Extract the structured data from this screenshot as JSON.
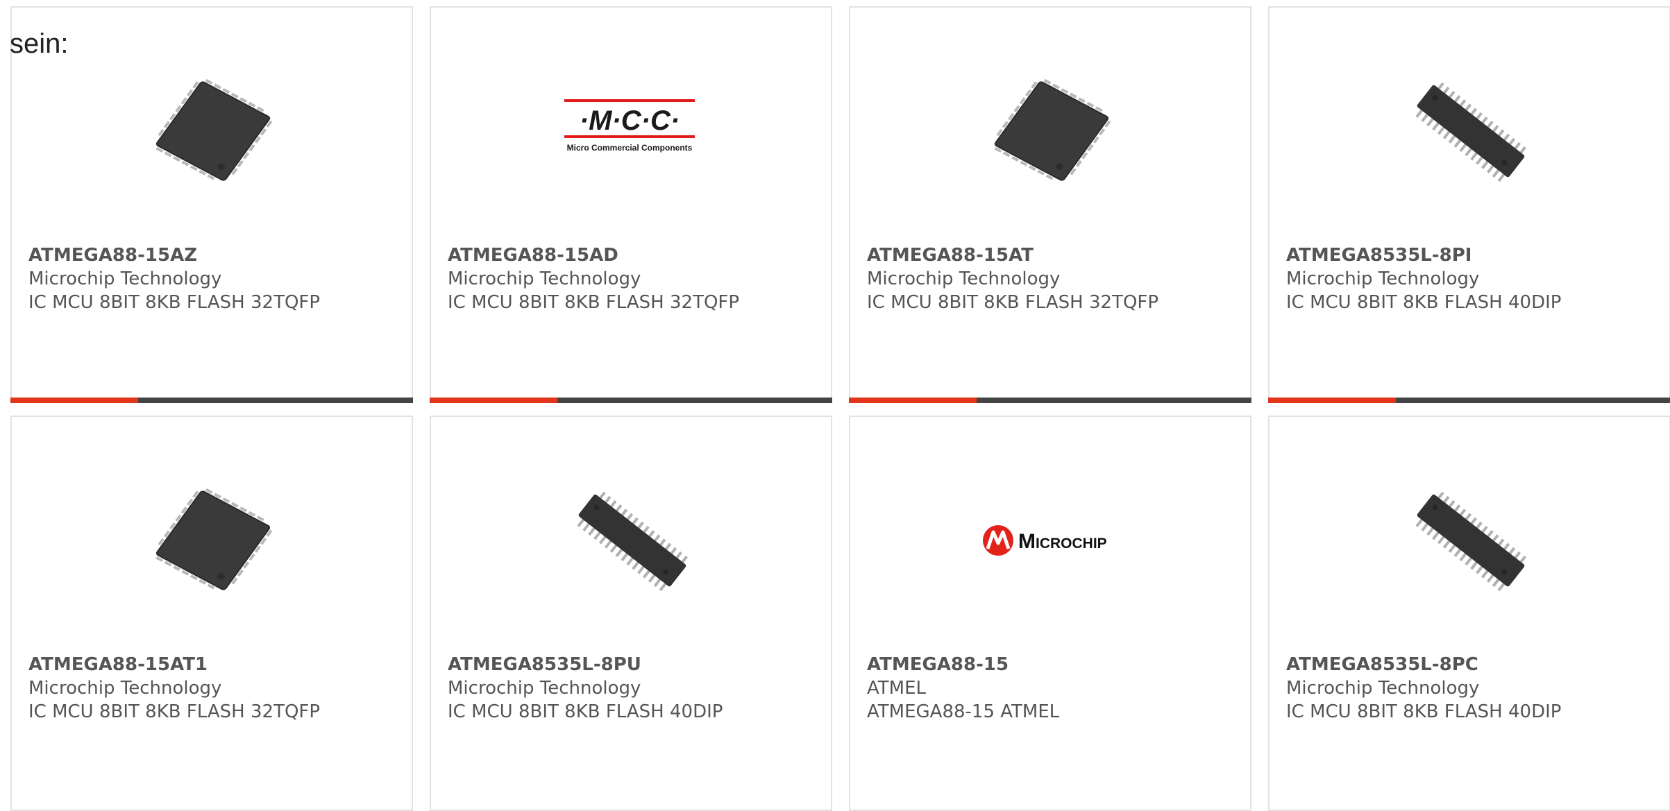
{
  "intro_text": "sein:",
  "colors": {
    "accent": "#e2361a",
    "bar": "#444444",
    "border": "#e2e2e2",
    "text": "#555555"
  },
  "products": [
    {
      "part": "ATMEGA88-15AZ",
      "manufacturer": "Microchip Technology",
      "description": "IC MCU 8BIT 8KB FLASH 32TQFP",
      "image": "tqfp-chip-icon"
    },
    {
      "part": "ATMEGA88-15AD",
      "manufacturer": "Microchip Technology",
      "description": "IC MCU 8BIT 8KB FLASH 32TQFP",
      "image": "mcc-logo",
      "logo_text": "·M·C·C·",
      "logo_subtext": "Micro Commercial Components"
    },
    {
      "part": "ATMEGA88-15AT",
      "manufacturer": "Microchip Technology",
      "description": "IC MCU 8BIT 8KB FLASH 32TQFP",
      "image": "tqfp-chip-icon"
    },
    {
      "part": "ATMEGA8535L-8PI",
      "manufacturer": "Microchip Technology",
      "description": "IC MCU 8BIT 8KB FLASH 40DIP",
      "image": "dip-chip-icon"
    },
    {
      "part": "ATMEGA88-15AT1",
      "manufacturer": "Microchip Technology",
      "description": "IC MCU 8BIT 8KB FLASH 32TQFP",
      "image": "tqfp-chip-icon"
    },
    {
      "part": "ATMEGA8535L-8PU",
      "manufacturer": "Microchip Technology",
      "description": "IC MCU 8BIT 8KB FLASH 40DIP",
      "image": "dip-chip-icon"
    },
    {
      "part": "ATMEGA88-15",
      "manufacturer": "ATMEL",
      "description": "ATMEGA88-15 ATMEL",
      "image": "microchip-logo",
      "logo_text": "Microchip"
    },
    {
      "part": "ATMEGA8535L-8PC",
      "manufacturer": "Microchip Technology",
      "description": "IC MCU 8BIT 8KB FLASH 40DIP",
      "image": "dip-chip-icon"
    }
  ]
}
